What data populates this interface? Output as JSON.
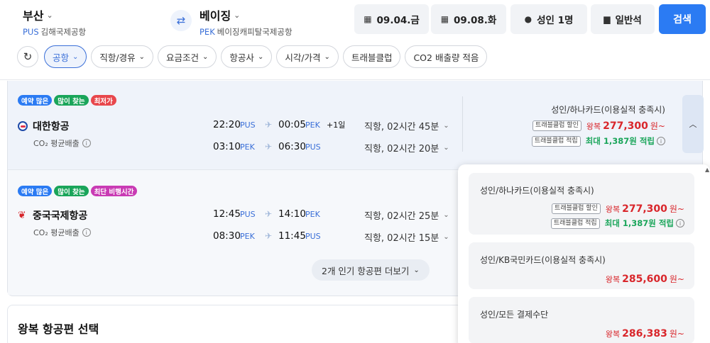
{
  "header": {
    "origin": {
      "city": "부산",
      "code": "PUS",
      "airport": "김해국제공항"
    },
    "destination": {
      "city": "베이징",
      "code": "PEK",
      "airport": "베이징캐피탈국제공항"
    },
    "depart_date": "09.04.금",
    "return_date": "09.08.화",
    "passengers": "성인 1명",
    "cabin": "일반석",
    "search_label": "검색"
  },
  "filters": [
    {
      "label": "공항",
      "active": true
    },
    {
      "label": "직항/경유",
      "active": false
    },
    {
      "label": "요금조건",
      "active": false
    },
    {
      "label": "항공사",
      "active": false
    },
    {
      "label": "시각/가격",
      "active": false
    },
    {
      "label": "트래블클럽",
      "active": false
    },
    {
      "label": "CO2 배출량 적음",
      "active": false
    }
  ],
  "results": [
    {
      "tags": [
        "예약 많은",
        "많이 찾는",
        "최저가"
      ],
      "airline": "대한항공",
      "co2": "CO₂ 평균배출",
      "legs": [
        {
          "dep_time": "22:20",
          "dep_ap": "PUS",
          "arr_time": "00:05",
          "arr_ap": "PEK",
          "plus": "+1일",
          "duration": "직항, 02시간 45분"
        },
        {
          "dep_time": "03:10",
          "dep_ap": "PEK",
          "arr_time": "06:30",
          "arr_ap": "PUS",
          "plus": "",
          "duration": "직항, 02시간 20분"
        }
      ],
      "price_title": "성인/하나카드(이용실적 충족시)",
      "discount_badge": "트래블클럽 할인",
      "round_label": "왕복",
      "price": "277,300",
      "won": "원~",
      "mile_badge": "트래블클럽 적립",
      "mile_text": "최대 1,387원 적립"
    },
    {
      "tags": [
        "예약 많은",
        "많이 찾는",
        "최단 비행시간"
      ],
      "airline": "중국국제항공",
      "co2": "CO₂ 평균배출",
      "legs": [
        {
          "dep_time": "12:45",
          "dep_ap": "PUS",
          "arr_time": "14:10",
          "arr_ap": "PEK",
          "plus": "",
          "duration": "직항, 02시간 25분"
        },
        {
          "dep_time": "08:30",
          "dep_ap": "PEK",
          "arr_time": "11:45",
          "arr_ap": "PUS",
          "plus": "",
          "duration": "직항, 02시간 15분"
        }
      ]
    }
  ],
  "more_button": "2개 인기 항공편 더보기",
  "section_title": "왕복 항공편 선택",
  "panel_options": [
    {
      "title": "성인/하나카드(이용실적 충족시)",
      "discount_badge": "트래블클럽 할인",
      "round_label": "왕복",
      "price": "277,300",
      "won": "원~",
      "mile_badge": "트래블클럽 적립",
      "mile_text": "최대 1,387원 적립"
    },
    {
      "title": "성인/KB국민카드(이용실적 충족시)",
      "round_label": "왕복",
      "price": "285,600",
      "won": "원~"
    },
    {
      "title": "성인/모든 결제수단",
      "round_label": "왕복",
      "price": "286,383",
      "won": "원~"
    }
  ],
  "colors": {
    "accent": "#2b7bf3",
    "price": "#d9262b",
    "mile": "#1aa55a"
  }
}
